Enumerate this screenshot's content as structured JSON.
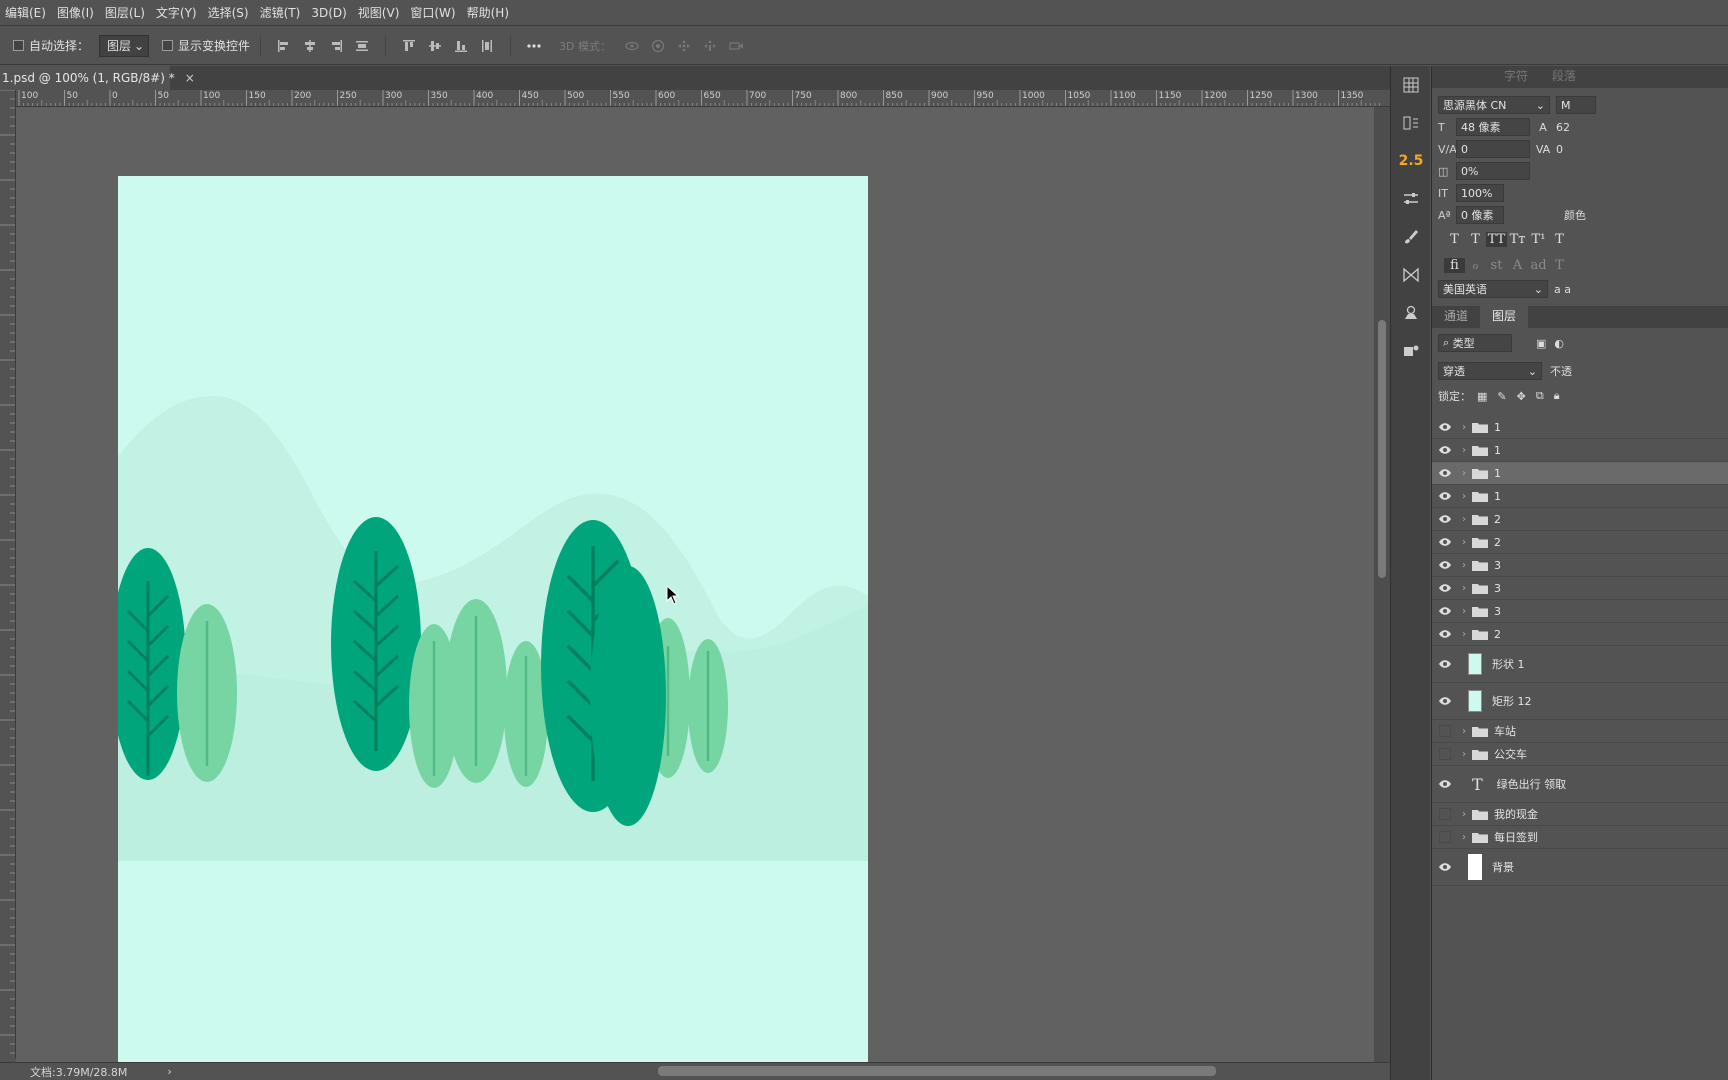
{
  "menu": [
    "编辑(E)",
    "图像(I)",
    "图层(L)",
    "文字(Y)",
    "选择(S)",
    "滤镜(T)",
    "3D(D)",
    "视图(V)",
    "窗口(W)",
    "帮助(H)"
  ],
  "options": {
    "auto_select_label": "自动选择：",
    "auto_select_value": "图层",
    "show_transform_label": "显示变换控件",
    "mode_3d_label": "3D 模式："
  },
  "document": {
    "tab_title": "1.psd @ 100% (1, RGB/8#) *",
    "close_glyph": "×",
    "status": "文档:3.79M/28.8M",
    "status_arrow": "›"
  },
  "ruler": {
    "labels": [
      "100",
      "50",
      "0",
      "50",
      "100",
      "150",
      "200",
      "250",
      "300",
      "350",
      "400",
      "450",
      "500",
      "550",
      "600",
      "650",
      "700",
      "750",
      "800",
      "850",
      "900",
      "950",
      "1000",
      "1050",
      "1100",
      "1150",
      "1200",
      "1250",
      "1300",
      "1350"
    ]
  },
  "artboard": {
    "bg_color": "#cdfaee",
    "hill_color": "#bcefdf",
    "tree_dark": "#00a57b",
    "tree_light": "#77d5a3",
    "vein_dark": "#02805e",
    "vein_light": "#52b885"
  },
  "dock": {
    "badge_value": "2.5"
  },
  "character_panel": {
    "tabs": [
      "字符",
      "段落"
    ],
    "font_family": "思源黑体 CN",
    "font_style_initial": "M",
    "size": "48 像素",
    "leading": "62",
    "tracking": "0",
    "kerning": "0",
    "scale_pct": "0%",
    "vertical_scale": "100%",
    "baseline_shift": "0 像素",
    "color_label": "颜色",
    "language": "美国英语",
    "aa_label": "a a",
    "style_buttons": [
      "T",
      "T",
      "TT",
      "Tт",
      "T¹",
      "T"
    ],
    "feature_buttons": [
      "fi",
      "ℴ",
      "st",
      "A",
      "ad",
      "T"
    ]
  },
  "layers_panel": {
    "tabs": [
      "通道",
      "图层"
    ],
    "filter_label": "类型",
    "blend_mode": "穿透",
    "opacity_label": "不透",
    "lock_label": "锁定：",
    "layers": [
      {
        "name": "1",
        "kind": "group",
        "visible": true,
        "selected": false
      },
      {
        "name": "1",
        "kind": "group",
        "visible": true,
        "selected": false
      },
      {
        "name": "1",
        "kind": "group",
        "visible": true,
        "selected": true
      },
      {
        "name": "1",
        "kind": "group",
        "visible": true,
        "selected": false
      },
      {
        "name": "2",
        "kind": "group",
        "visible": true,
        "selected": false
      },
      {
        "name": "2",
        "kind": "group",
        "visible": true,
        "selected": false
      },
      {
        "name": "3",
        "kind": "group",
        "visible": true,
        "selected": false
      },
      {
        "name": "3",
        "kind": "group",
        "visible": true,
        "selected": false
      },
      {
        "name": "3",
        "kind": "group",
        "visible": true,
        "selected": false
      },
      {
        "name": "2",
        "kind": "group",
        "visible": true,
        "selected": false
      },
      {
        "name": "形状 1",
        "kind": "shape",
        "visible": true,
        "selected": false
      },
      {
        "name": "矩形 12",
        "kind": "shape",
        "visible": true,
        "selected": false
      },
      {
        "name": "车站",
        "kind": "group",
        "visible": false,
        "selected": false
      },
      {
        "name": "公交车",
        "kind": "group",
        "visible": false,
        "selected": false
      },
      {
        "name": "绿色出行 领取",
        "kind": "text",
        "visible": true,
        "selected": false
      },
      {
        "name": "我的现金",
        "kind": "group",
        "visible": false,
        "selected": false
      },
      {
        "name": "每日签到",
        "kind": "group",
        "visible": false,
        "selected": false
      },
      {
        "name": "背景",
        "kind": "background",
        "visible": true,
        "selected": false
      }
    ]
  }
}
